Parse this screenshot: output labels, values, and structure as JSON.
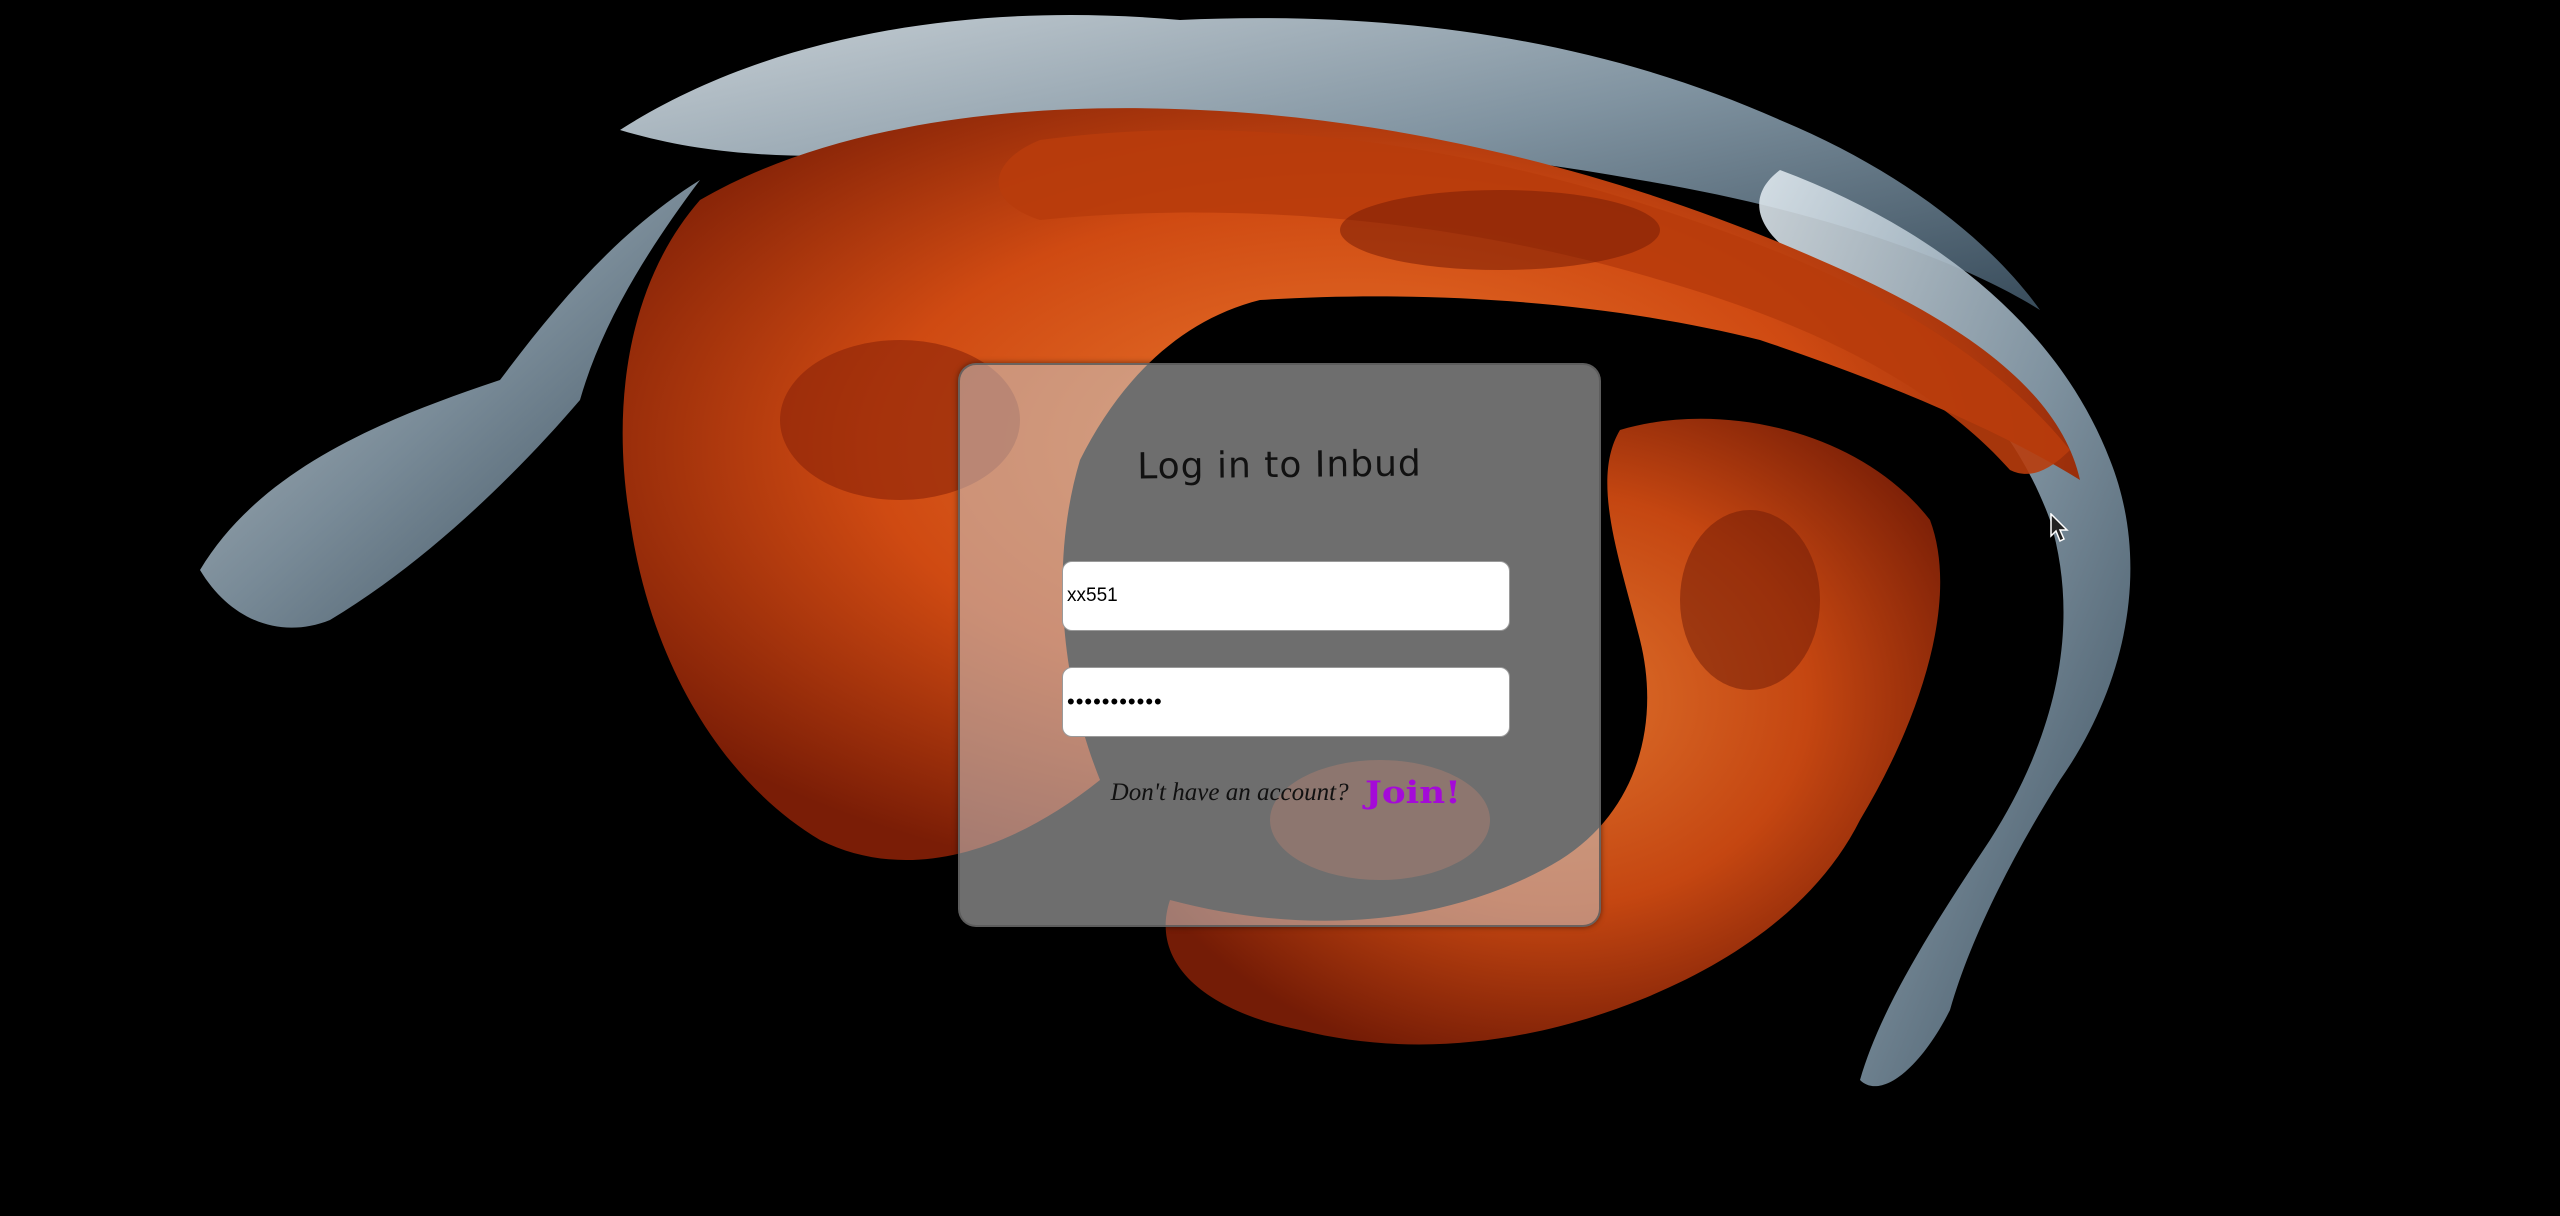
{
  "login": {
    "title": "Log in to Inbud",
    "username_value": "xx551",
    "password_value": "•••••••••••",
    "join_prompt": "Don't have an account?",
    "join_label": "Join!"
  },
  "colors": {
    "page_background": "#000000",
    "card_background": "#c8c8c8",
    "join_link": "#a40ad8",
    "art_orange": "#d9531a",
    "art_blue_gray": "#8fa3b3"
  }
}
